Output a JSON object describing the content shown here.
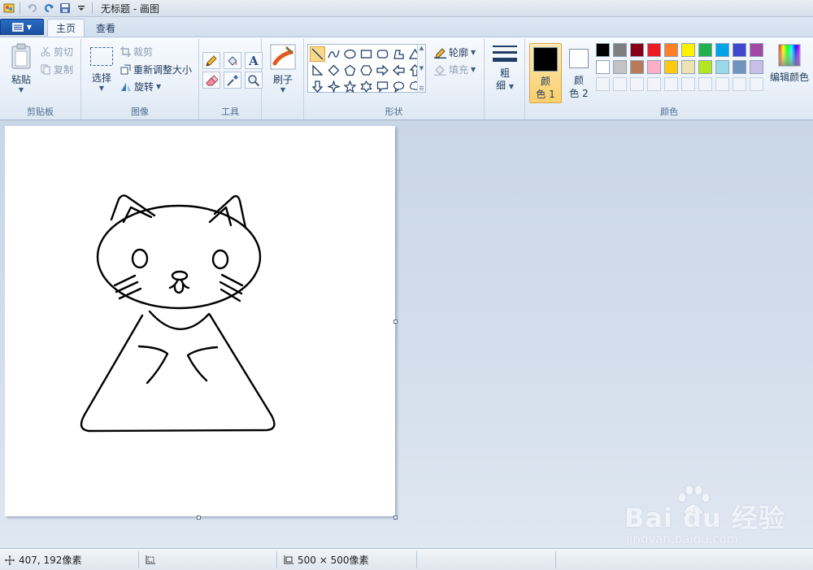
{
  "window": {
    "title": "无标题 - 画图"
  },
  "tabs": {
    "home": "主页",
    "view": "查看"
  },
  "clipboard": {
    "paste": "粘贴",
    "cut": "剪切",
    "copy": "复制",
    "label": "剪贴板"
  },
  "image": {
    "select": "选择",
    "crop": "裁剪",
    "resize": "重新调整大小",
    "rotate": "旋转",
    "label": "图像"
  },
  "tools": {
    "label": "工具",
    "text_tool_glyph": "A"
  },
  "brushes": {
    "label": "刷子"
  },
  "shapes": {
    "label": "形状",
    "outline": "轮廓",
    "fill": "填充"
  },
  "size": {
    "line1": "粗",
    "line2": "细"
  },
  "colors": {
    "color1_line1": "颜",
    "color1_line2": "色 1",
    "color2_line1": "颜",
    "color2_line2": "色 2",
    "edit": "编辑颜色",
    "label": "颜色",
    "color1_value": "#000000",
    "color2_value": "#ffffff",
    "palette_row1": [
      "#000000",
      "#7f7f7f",
      "#880015",
      "#ed1c24",
      "#ff7f27",
      "#fff200",
      "#22b14c",
      "#00a2e8",
      "#3f48cc",
      "#a349a4"
    ],
    "palette_row2": [
      "#ffffff",
      "#c3c3c3",
      "#b97a57",
      "#ffaec9",
      "#ffc90e",
      "#efe4b0",
      "#b5e61d",
      "#99d9ea",
      "#7092be",
      "#c8bfe7"
    ]
  },
  "status": {
    "cursor_pos": "407, 192像素",
    "selection_size": "",
    "canvas_size": "500 × 500像素"
  },
  "watermark": {
    "brand": "Bai du 经验",
    "url": "jingyan.baidu.com"
  }
}
